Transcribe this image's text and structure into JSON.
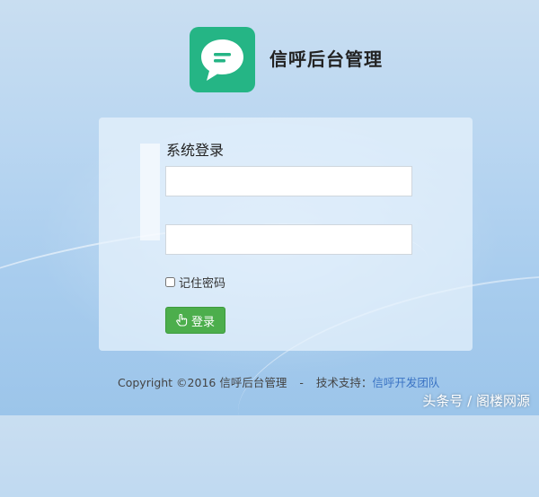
{
  "app": {
    "title": "信呼后台管理",
    "logo_icon": "chat-bubble-icon",
    "logo_color": "#25b585"
  },
  "login_form": {
    "title": "系统登录",
    "username_value": "",
    "password_value": "",
    "remember_label": "记住密码",
    "remember_checked": false,
    "login_button_label": "登录",
    "login_button_icon": "hand-pointer-icon",
    "button_color": "#4cae4c"
  },
  "footer": {
    "copyright": "Copyright ©2016 信呼后台管理",
    "separator": "-",
    "support_label": "技术支持：",
    "support_link": "信呼开发团队"
  },
  "watermark": "头条号 / 阁楼网源"
}
